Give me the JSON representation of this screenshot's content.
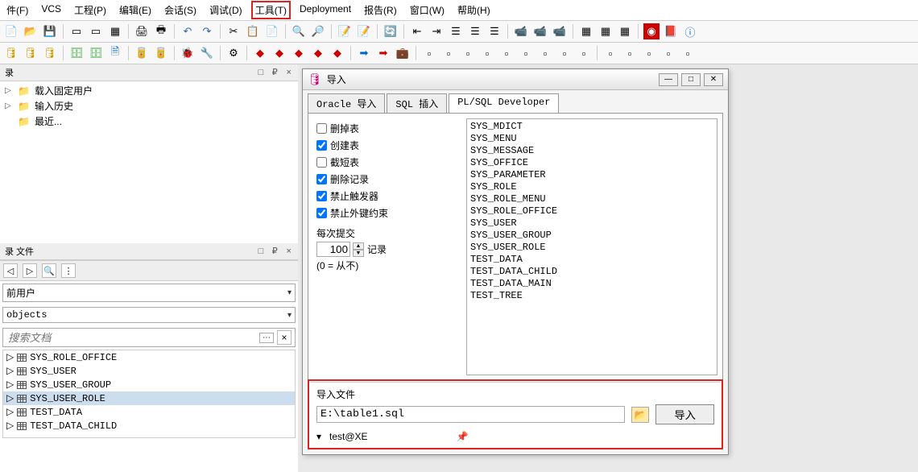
{
  "menu": {
    "items": [
      "件(F)",
      "VCS",
      "工程(P)",
      "编辑(E)",
      "会话(S)",
      "调试(D)",
      "工具(T)",
      "Deployment",
      "报告(R)",
      "窗口(W)",
      "帮助(H)"
    ],
    "highlight_index": 6
  },
  "left": {
    "panel1": {
      "title": "录",
      "ctrls": "□ ₽ ×"
    },
    "recent": {
      "items": [
        "载入固定用户",
        "输入历史",
        "最近..."
      ]
    },
    "panel2": {
      "title": "录  文件",
      "ctrls": "□ ₽ ×"
    },
    "current_user_label": "前用户",
    "objects_label": "objects",
    "search_placeholder": "搜索文档",
    "obj_rows": [
      "SYS_ROLE_OFFICE",
      "SYS_USER",
      "SYS_USER_GROUP",
      "SYS_USER_ROLE",
      "TEST_DATA",
      "TEST_DATA_CHILD"
    ],
    "obj_selected": "SYS_USER_ROLE"
  },
  "dialog": {
    "title": "导入",
    "tabs": [
      "Oracle 导入",
      "SQL 插入",
      "PL/SQL Developer"
    ],
    "active_tab": 2,
    "options": {
      "drop_tables_label": "删掉表",
      "drop_tables": false,
      "create_tables_label": "创建表",
      "create_tables": true,
      "truncate_tables_label": "截短表",
      "truncate_tables": false,
      "delete_records_label": "删除记录",
      "delete_records": true,
      "disable_triggers_label": "禁止触发器",
      "disable_triggers": true,
      "disable_fk_label": "禁止外键约束",
      "disable_fk": true,
      "commit_every_label": "每次提交",
      "commit_every_value": "100",
      "records_label": "记录",
      "zero_never_label": "(0 = 从不)"
    },
    "tables": [
      "SYS_MDICT",
      "SYS_MENU",
      "SYS_MESSAGE",
      "SYS_OFFICE",
      "SYS_PARAMETER",
      "SYS_ROLE",
      "SYS_ROLE_MENU",
      "SYS_ROLE_OFFICE",
      "SYS_USER",
      "SYS_USER_GROUP",
      "SYS_USER_ROLE",
      "TEST_DATA",
      "TEST_DATA_CHILD",
      "TEST_DATA_MAIN",
      "TEST_TREE"
    ],
    "import_file_label": "导入文件",
    "file_path": "E:\\table1.sql",
    "import_btn": "导入",
    "status": "test@XE"
  },
  "win_btns": {
    "min": "—",
    "max": "□",
    "close": "✕"
  }
}
